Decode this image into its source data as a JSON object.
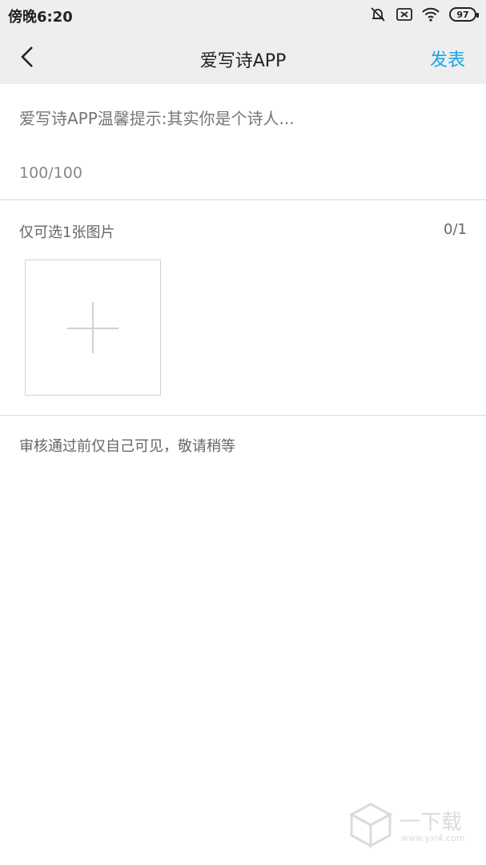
{
  "status_bar": {
    "time": "傍晚6:20",
    "battery": "97",
    "icons": [
      "silent-alarm-icon",
      "x-box-icon",
      "wifi-icon",
      "battery-icon"
    ]
  },
  "header": {
    "title": "爱写诗APP",
    "publish_label": "发表",
    "back_icon": "chevron-left-icon"
  },
  "compose": {
    "placeholder": "爱写诗APP温馨提示:其实你是个诗人...",
    "counter": "100/100"
  },
  "images": {
    "hint": "仅可选1张图片",
    "count": "0/1",
    "add_icon": "plus-icon"
  },
  "footer_note": "审核通过前仅自己可见，敬请稍等",
  "watermark": {
    "text": "一下载",
    "url": "www.yxi4.com"
  },
  "colors": {
    "accent": "#1aa3e8",
    "bar_bg": "#eeeeee",
    "divider": "#dcdcdc"
  }
}
